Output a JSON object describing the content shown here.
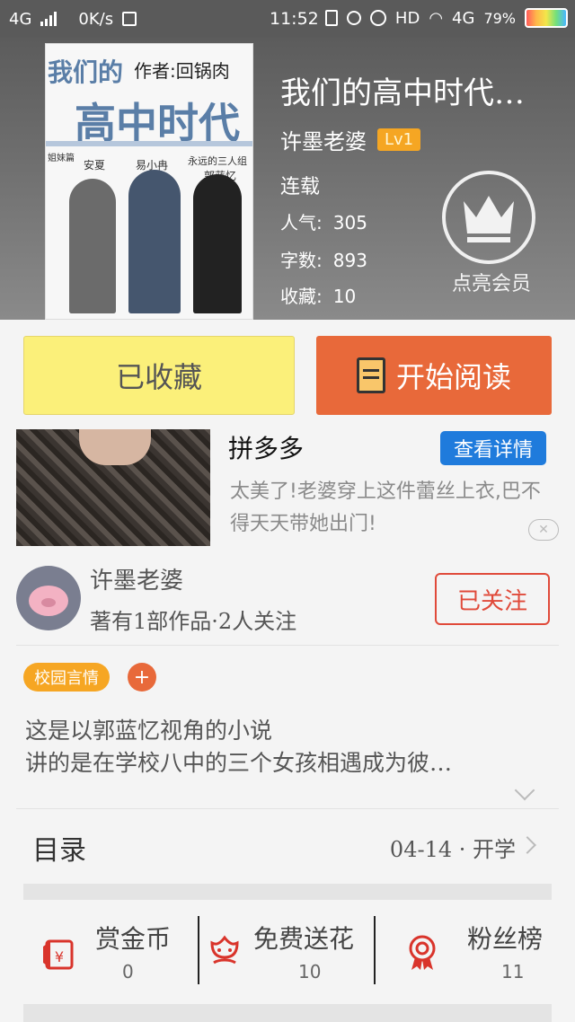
{
  "status_bar": {
    "network": "4G",
    "speed": "0K/s",
    "time": "11:52",
    "hd": "HD",
    "net2": "4G",
    "battery": "79%"
  },
  "book": {
    "cover_text_1": "我们的",
    "cover_author": "作者:回锅肉",
    "cover_text_2": "高中时代",
    "cover_names": [
      "安夏",
      "易小冉",
      "郭蓝忆",
      "永远的三人组",
      "姐妹篇"
    ],
    "title": "我们的高中时代…",
    "author": "许墨老婆",
    "level": "Lv1",
    "status": "连载",
    "stats": [
      {
        "label": "人气:",
        "value": "305"
      },
      {
        "label": "字数:",
        "value": "893"
      },
      {
        "label": "收藏:",
        "value": "10"
      }
    ],
    "vip_label": "点亮会员"
  },
  "actions": {
    "collected": "已收藏",
    "start_reading": "开始阅读"
  },
  "ad": {
    "brand": "拼多多",
    "detail": "查看详情",
    "text": "太美了!老婆穿上这件蕾丝上衣,巴不得天天带她出门!",
    "close": "✕"
  },
  "author_row": {
    "name": "许墨老婆",
    "meta": "著有1部作品·2人关注",
    "follow": "已关注"
  },
  "tags": {
    "tag": "校园言情",
    "add": "+"
  },
  "intro": {
    "line1": "这是以郭蓝忆视角的小说",
    "line2": "讲的是在学校八中的三个女孩相遇成为彼…"
  },
  "catalog": {
    "title": "目录",
    "latest": "04-14 · 开学"
  },
  "bottom_stats": [
    {
      "label": "赏金币",
      "value": "0",
      "icon": "red-envelope-yen-icon"
    },
    {
      "label": "免费送花",
      "value": "10",
      "icon": "flower-icon"
    },
    {
      "label": "粉丝榜",
      "value": "11",
      "icon": "medal-icon"
    }
  ],
  "colors": {
    "accent_orange": "#e8693a",
    "collected_yellow": "#fbf07a",
    "follow_red": "#e04a3a",
    "tag_orange": "#f6a623",
    "ad_blue": "#1f7bdc"
  }
}
